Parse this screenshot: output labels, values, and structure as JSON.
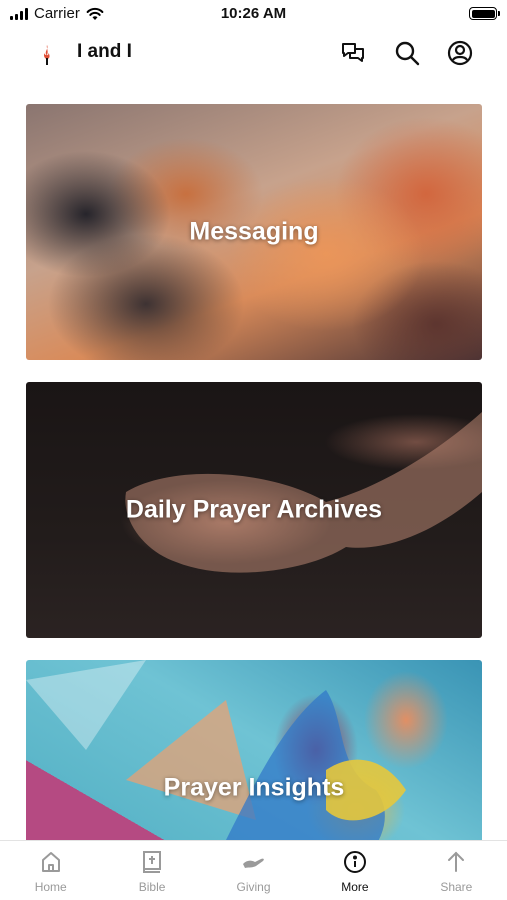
{
  "status_bar": {
    "carrier": "Carrier",
    "time": "10:26 AM"
  },
  "header": {
    "app_title": "I and I",
    "logo_color": "#e0523a",
    "icons": [
      "chat-icon",
      "search-icon",
      "profile-icon"
    ]
  },
  "cards": [
    {
      "label": "Messaging"
    },
    {
      "label": "Daily Prayer Archives"
    },
    {
      "label": "Prayer Insights"
    }
  ],
  "tabs": [
    {
      "label": "Home",
      "icon": "home-icon",
      "active": false
    },
    {
      "label": "Bible",
      "icon": "bible-icon",
      "active": false
    },
    {
      "label": "Giving",
      "icon": "giving-icon",
      "active": false
    },
    {
      "label": "More",
      "icon": "info-icon",
      "active": true
    },
    {
      "label": "Share",
      "icon": "share-icon",
      "active": false
    }
  ]
}
